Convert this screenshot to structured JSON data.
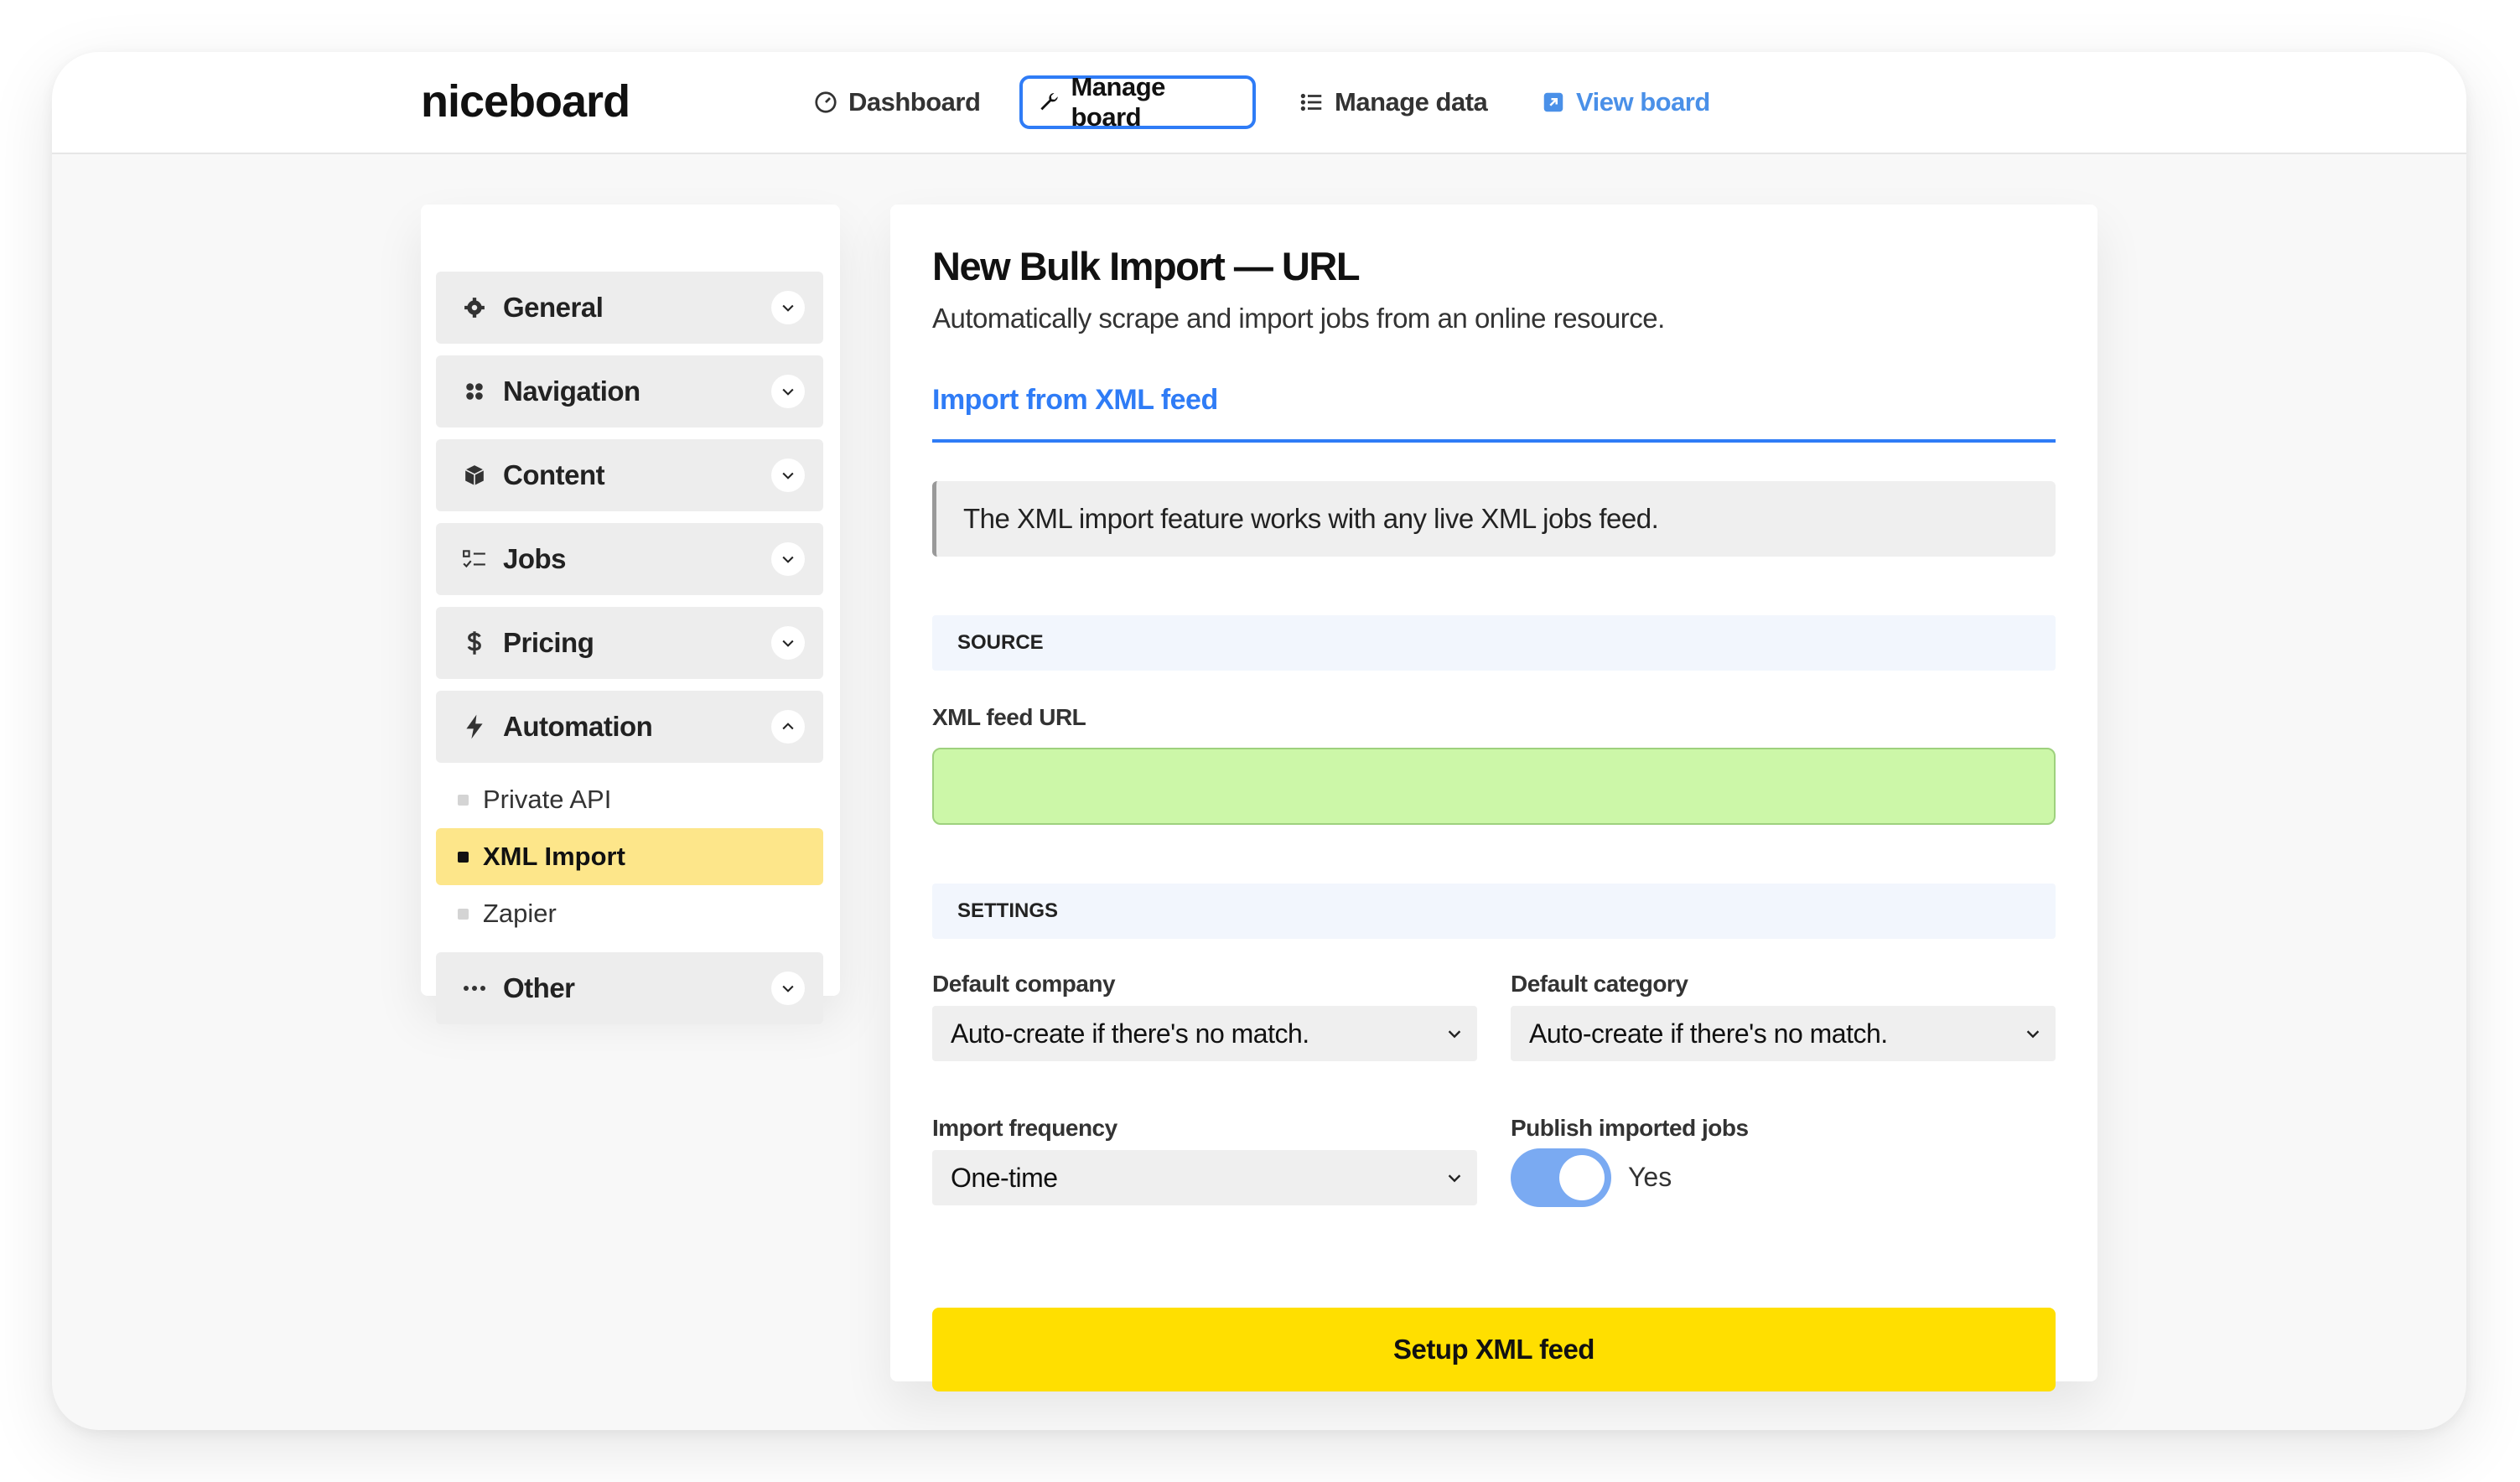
{
  "app": {
    "logo": "niceboard"
  },
  "nav": {
    "dashboard": "Dashboard",
    "manage_board": "Manage board",
    "manage_data": "Manage data",
    "view_board": "View board"
  },
  "sidebar": {
    "items": [
      {
        "label": "General",
        "icon": "gear-icon",
        "expanded": false
      },
      {
        "label": "Navigation",
        "icon": "grid-dots-icon",
        "expanded": false
      },
      {
        "label": "Content",
        "icon": "cube-icon",
        "expanded": false
      },
      {
        "label": "Jobs",
        "icon": "checklist-icon",
        "expanded": false
      },
      {
        "label": "Pricing",
        "icon": "dollar-icon",
        "expanded": false
      },
      {
        "label": "Automation",
        "icon": "lightning-icon",
        "expanded": true
      },
      {
        "label": "Other",
        "icon": "ellipsis-icon",
        "expanded": false
      }
    ],
    "sub_items": [
      {
        "label": "Private API",
        "active": false
      },
      {
        "label": "XML Import",
        "active": true
      },
      {
        "label": "Zapier",
        "active": false
      }
    ]
  },
  "panel": {
    "title": "New Bulk Import — URL",
    "subtitle": "Automatically scrape and import jobs from an online resource.",
    "tab": "Import from XML feed",
    "notice": "The XML import feature works with any live XML jobs feed.",
    "source_heading": "SOURCE",
    "url_label": "XML feed URL",
    "url_value": "",
    "settings_heading": "SETTINGS",
    "default_company_label": "Default company",
    "default_company_value": "Auto-create if there's no match.",
    "default_category_label": "Default category",
    "default_category_value": "Auto-create if there's no match.",
    "frequency_label": "Import frequency",
    "frequency_value": "One-time",
    "publish_label": "Publish imported jobs",
    "publish_value": "Yes",
    "submit_label": "Setup XML feed"
  },
  "colors": {
    "accent": "#2f7cf6",
    "link": "#4a90e8",
    "highlight": "#fde68a",
    "cta": "#ffdf00",
    "input_bg": "#ccf7a8",
    "toggle": "#7aaaf2"
  }
}
